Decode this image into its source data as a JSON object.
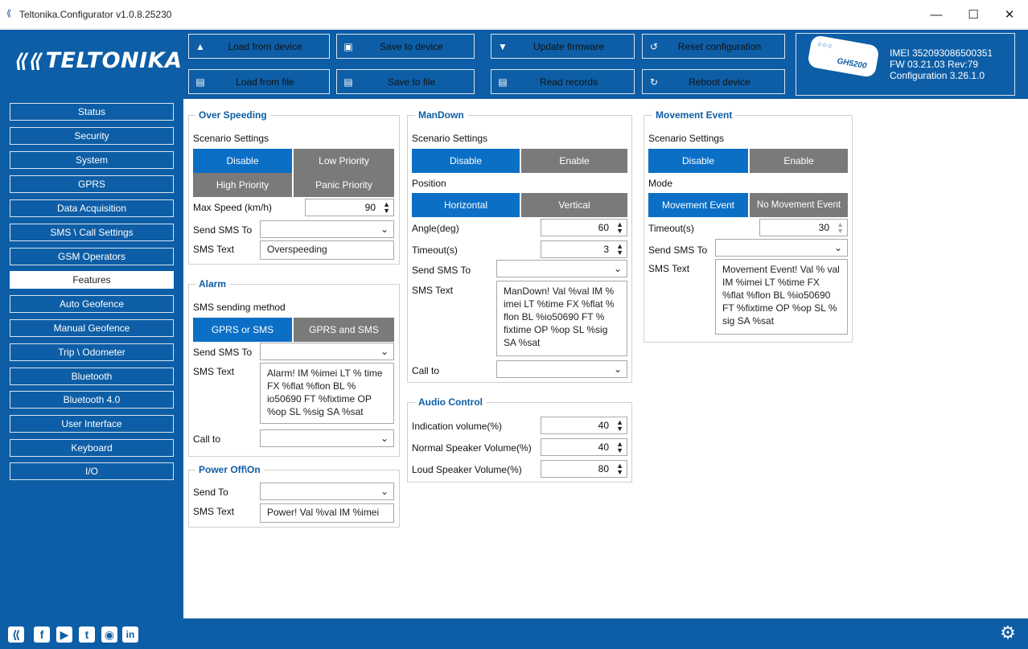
{
  "window": {
    "title": "Teltonika.Configurator v1.0.8.25230",
    "minimize": "—",
    "maximize": "☐",
    "close": "✕"
  },
  "header": {
    "logo": "TELTONIKA",
    "buttons": {
      "load_device": "Load from device",
      "save_device": "Save to device",
      "update_firmware": "Update firmware",
      "reset_config": "Reset configuration",
      "load_file": "Load from file",
      "save_file": "Save to file",
      "read_records": "Read records",
      "reboot": "Reboot device"
    },
    "device": {
      "model": "GH5200",
      "imei": "IMEI 352093086500351",
      "fw": "FW 03.21.03 Rev:79",
      "configuration": "Configuration 3.26.1.0"
    }
  },
  "sidebar": {
    "items": [
      "Status",
      "Security",
      "System",
      "GPRS",
      "Data Acquisition",
      "SMS \\ Call Settings",
      "GSM Operators",
      "Features",
      "Auto Geofence",
      "Manual Geofence",
      "Trip \\ Odometer",
      "Bluetooth",
      "Bluetooth 4.0",
      "User Interface",
      "Keyboard",
      "I/O"
    ],
    "active": "Features"
  },
  "over_speeding": {
    "title": "Over Speeding",
    "scenario_label": "Scenario Settings",
    "options": [
      "Disable",
      "Low Priority",
      "High Priority",
      "Panic Priority"
    ],
    "selected": "Disable",
    "max_speed_label": "Max Speed (km/h)",
    "max_speed": "90",
    "send_sms_label": "Send SMS To",
    "send_sms_value": "",
    "sms_text_label": "SMS Text",
    "sms_text": "Overspeeding"
  },
  "alarm": {
    "title": "Alarm",
    "method_label": "SMS sending method",
    "options": [
      "GPRS or SMS",
      "GPRS and SMS"
    ],
    "selected": "GPRS or SMS",
    "send_sms_label": "Send SMS To",
    "send_sms_value": "",
    "sms_text_label": "SMS Text",
    "sms_text": "Alarm! IM %imei LT % time FX %flat %flon BL % io50690 FT %fixtime OP %op SL %sig SA %sat",
    "call_to_label": "Call to",
    "call_to_value": ""
  },
  "power": {
    "title": "Power Off\\On",
    "send_to_label": "Send To",
    "send_to_value": "",
    "sms_text_label": "SMS Text",
    "sms_text": "Power! Val %val IM %imei"
  },
  "mandown": {
    "title": "ManDown",
    "scenario_label": "Scenario Settings",
    "options": [
      "Disable",
      "Enable"
    ],
    "selected": "Disable",
    "position_label": "Position",
    "position_options": [
      "Horizontal",
      "Vertical"
    ],
    "position_selected": "Horizontal",
    "angle_label": "Angle(deg)",
    "angle": "60",
    "timeout_label": "Timeout(s)",
    "timeout": "3",
    "send_sms_label": "Send SMS To",
    "send_sms_value": "",
    "sms_text_label": "SMS Text",
    "sms_text": "ManDown! Val %val IM % imei LT %time FX %flat % flon BL %io50690 FT % fixtime OP %op SL %sig SA %sat",
    "call_to_label": "Call to",
    "call_to_value": ""
  },
  "audio": {
    "title": "Audio Control",
    "indication_label": "Indication volume(%)",
    "indication": "40",
    "normal_label": "Normal Speaker Volume(%)",
    "normal": "40",
    "loud_label": "Loud Speaker Volume(%)",
    "loud": "80"
  },
  "movement": {
    "title": "Movement Event",
    "scenario_label": "Scenario Settings",
    "options": [
      "Disable",
      "Enable"
    ],
    "selected": "Disable",
    "mode_label": "Mode",
    "mode_options": [
      "Movement Event",
      "No Movement Event"
    ],
    "mode_selected": "Movement Event",
    "timeout_label": "Timeout(s)",
    "timeout": "30",
    "send_sms_label": "Send SMS To",
    "send_sms_value": "",
    "sms_text_label": "SMS Text",
    "sms_text": "Movement Event! Val % val IM %imei LT %time FX %flat %flon BL %io50690 FT %fixtime OP %op SL % sig SA %sat"
  },
  "footer": {
    "social_icons": [
      "teltonika-icon",
      "facebook-icon",
      "youtube-icon",
      "twitter-icon",
      "instagram-icon",
      "linkedin-icon"
    ],
    "settings_icon": "gear-icon"
  },
  "colors": {
    "brand_blue": "#0d5ea6",
    "selected_segment": "#0b6fc6",
    "unselected_segment": "#7a7a7a"
  }
}
